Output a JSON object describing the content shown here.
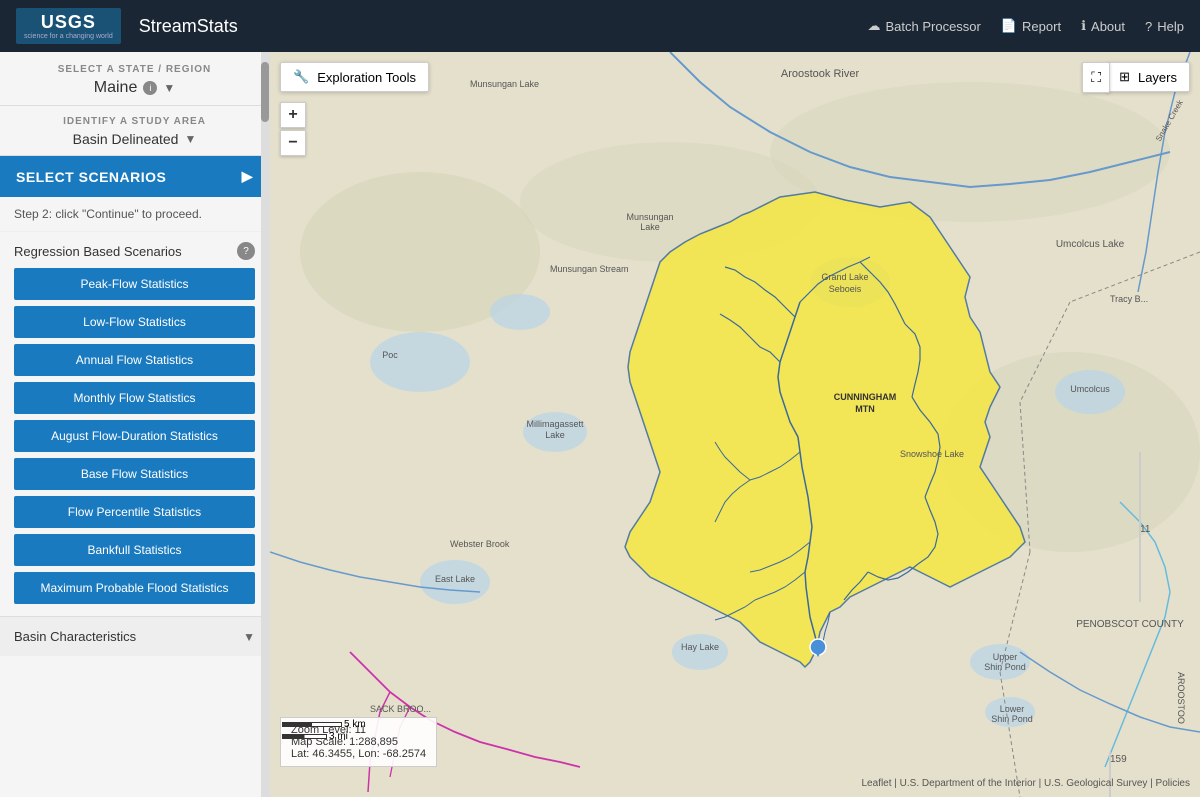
{
  "header": {
    "logo_text": "USGS",
    "logo_tagline": "science for a changing world",
    "app_title": "StreamStats",
    "nav": [
      {
        "id": "batch-processor",
        "icon": "☁",
        "label": "Batch Processor"
      },
      {
        "id": "report",
        "icon": "📄",
        "label": "Report"
      },
      {
        "id": "about",
        "icon": "ℹ",
        "label": "About"
      },
      {
        "id": "help",
        "icon": "?",
        "label": "Help"
      }
    ]
  },
  "sidebar": {
    "state_region_label": "SELECT A STATE / REGION",
    "state_name": "Maine",
    "study_area_label": "IDENTIFY A STUDY AREA",
    "study_area_value": "Basin Delineated",
    "select_scenarios_label": "SELECT SCENARIOS",
    "step_instruction": "Step 2: click \"Continue\" to proceed.",
    "regression_title": "Regression Based Scenarios",
    "stat_buttons": [
      "Peak-Flow Statistics",
      "Low-Flow Statistics",
      "Annual Flow Statistics",
      "Monthly Flow Statistics",
      "August Flow-Duration Statistics",
      "Base Flow Statistics",
      "Flow Percentile Statistics",
      "Bankfull Statistics",
      "Maximum Probable Flood Statistics"
    ],
    "basin_char_label": "Basin Characteristics"
  },
  "map": {
    "exploration_tools_label": "Exploration Tools",
    "zoom_in": "+",
    "zoom_out": "−",
    "layers_label": "Layers",
    "zoom_level": "Zoom Level: 11",
    "map_scale": "Map Scale: 1:288,895",
    "lat_lon": "Lat: 46.3455, Lon: -68.2574",
    "scale_km": "5 km",
    "scale_mi": "3 mi",
    "attribution": "Leaflet | U.S. Department of the Interior | U.S. Geological Survey | Policies"
  },
  "colors": {
    "header_bg": "#1a2634",
    "sidebar_bg": "#f5f5f5",
    "btn_blue": "#1a7abf",
    "map_bg": "#e8e0d0",
    "watershed_fill": "#f5e642",
    "watershed_stroke": "#1a5276",
    "river_stroke": "#6699cc",
    "accent_pink": "#cc33aa"
  }
}
